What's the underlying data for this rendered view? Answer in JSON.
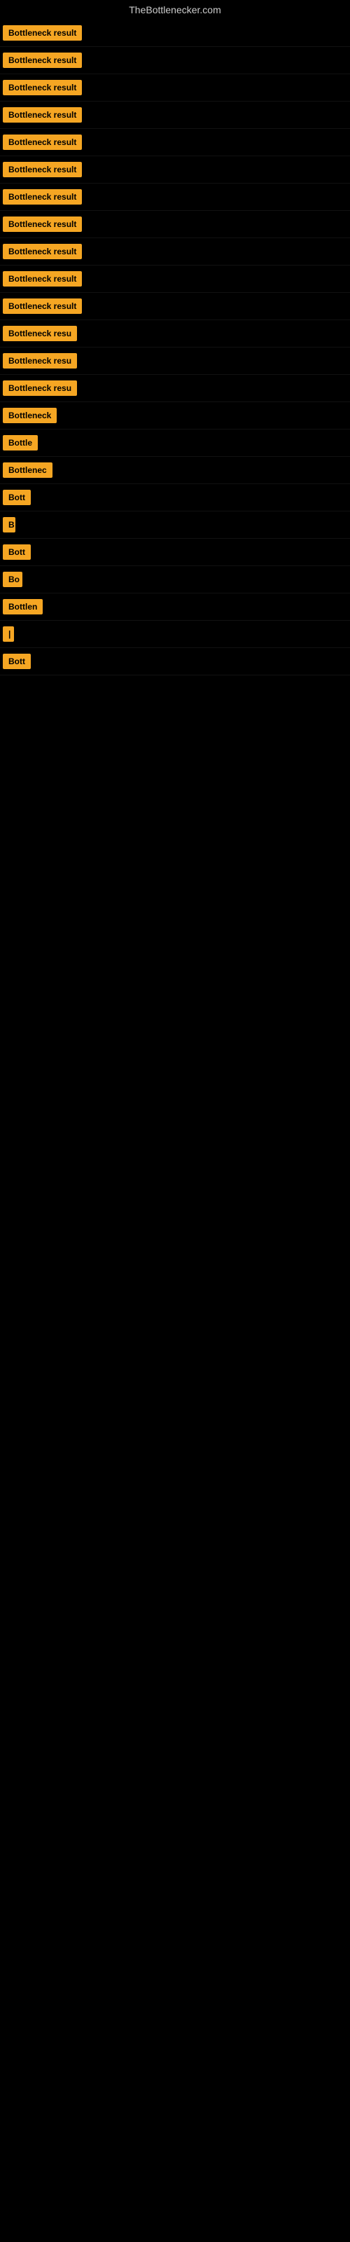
{
  "site": {
    "title": "TheBottlenecker.com"
  },
  "badges": [
    {
      "id": 1,
      "label": "Bottleneck result",
      "width": 155
    },
    {
      "id": 2,
      "label": "Bottleneck result",
      "width": 155
    },
    {
      "id": 3,
      "label": "Bottleneck result",
      "width": 155
    },
    {
      "id": 4,
      "label": "Bottleneck result",
      "width": 155
    },
    {
      "id": 5,
      "label": "Bottleneck result",
      "width": 155
    },
    {
      "id": 6,
      "label": "Bottleneck result",
      "width": 155
    },
    {
      "id": 7,
      "label": "Bottleneck result",
      "width": 155
    },
    {
      "id": 8,
      "label": "Bottleneck result",
      "width": 155
    },
    {
      "id": 9,
      "label": "Bottleneck result",
      "width": 155
    },
    {
      "id": 10,
      "label": "Bottleneck result",
      "width": 155
    },
    {
      "id": 11,
      "label": "Bottleneck result",
      "width": 155
    },
    {
      "id": 12,
      "label": "Bottleneck resu",
      "width": 140
    },
    {
      "id": 13,
      "label": "Bottleneck resu",
      "width": 140
    },
    {
      "id": 14,
      "label": "Bottleneck resu",
      "width": 140
    },
    {
      "id": 15,
      "label": "Bottleneck",
      "width": 100
    },
    {
      "id": 16,
      "label": "Bottle",
      "width": 60
    },
    {
      "id": 17,
      "label": "Bottlenec",
      "width": 88
    },
    {
      "id": 18,
      "label": "Bott",
      "width": 48
    },
    {
      "id": 19,
      "label": "B",
      "width": 18
    },
    {
      "id": 20,
      "label": "Bott",
      "width": 48
    },
    {
      "id": 21,
      "label": "Bo",
      "width": 28
    },
    {
      "id": 22,
      "label": "Bottlen",
      "width": 72
    },
    {
      "id": 23,
      "label": "|",
      "width": 10
    },
    {
      "id": 24,
      "label": "Bott",
      "width": 48
    }
  ]
}
